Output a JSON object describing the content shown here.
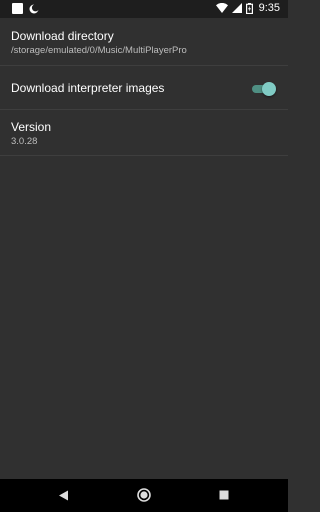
{
  "status_bar": {
    "time": "9:35",
    "icons": [
      "notification-square-icon",
      "moon-icon",
      "wifi-icon",
      "signal-icon",
      "battery-icon"
    ]
  },
  "preferences": [
    {
      "title": "Download directory",
      "summary": "/storage/emulated/0/Music/MultiPlayerPro"
    },
    {
      "title": "Download interpreter images",
      "toggle_on": true
    },
    {
      "title": "Version",
      "summary": "3.0.28"
    }
  ],
  "nav_bar": {
    "icons": [
      "back-icon",
      "home-icon",
      "recents-icon"
    ]
  },
  "colors": {
    "background": "#303030",
    "status_bar": "#1e1e1e",
    "accent": "#80cbc4",
    "nav_bar": "#000000"
  }
}
